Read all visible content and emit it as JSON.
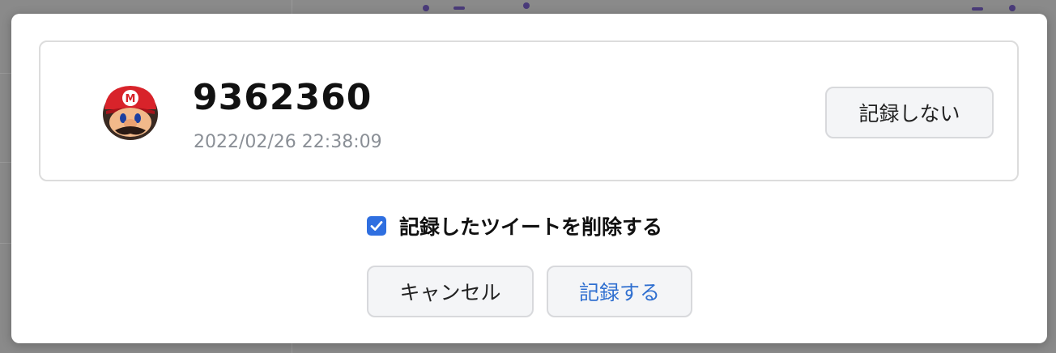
{
  "dialog": {
    "record": {
      "avatar_icon": "mario-head-icon",
      "score": "9362360",
      "timestamp": "2022/02/26 22:38:09",
      "skip_label": "記録しない"
    },
    "delete_tweet": {
      "checked": true,
      "label": "記録したツイートを削除する"
    },
    "cancel_label": "キャンセル",
    "record_label": "記録する"
  },
  "colors": {
    "accent": "#2f6fe0",
    "record_text": "#2f6fd0",
    "overlay": "#7c7c7c"
  }
}
